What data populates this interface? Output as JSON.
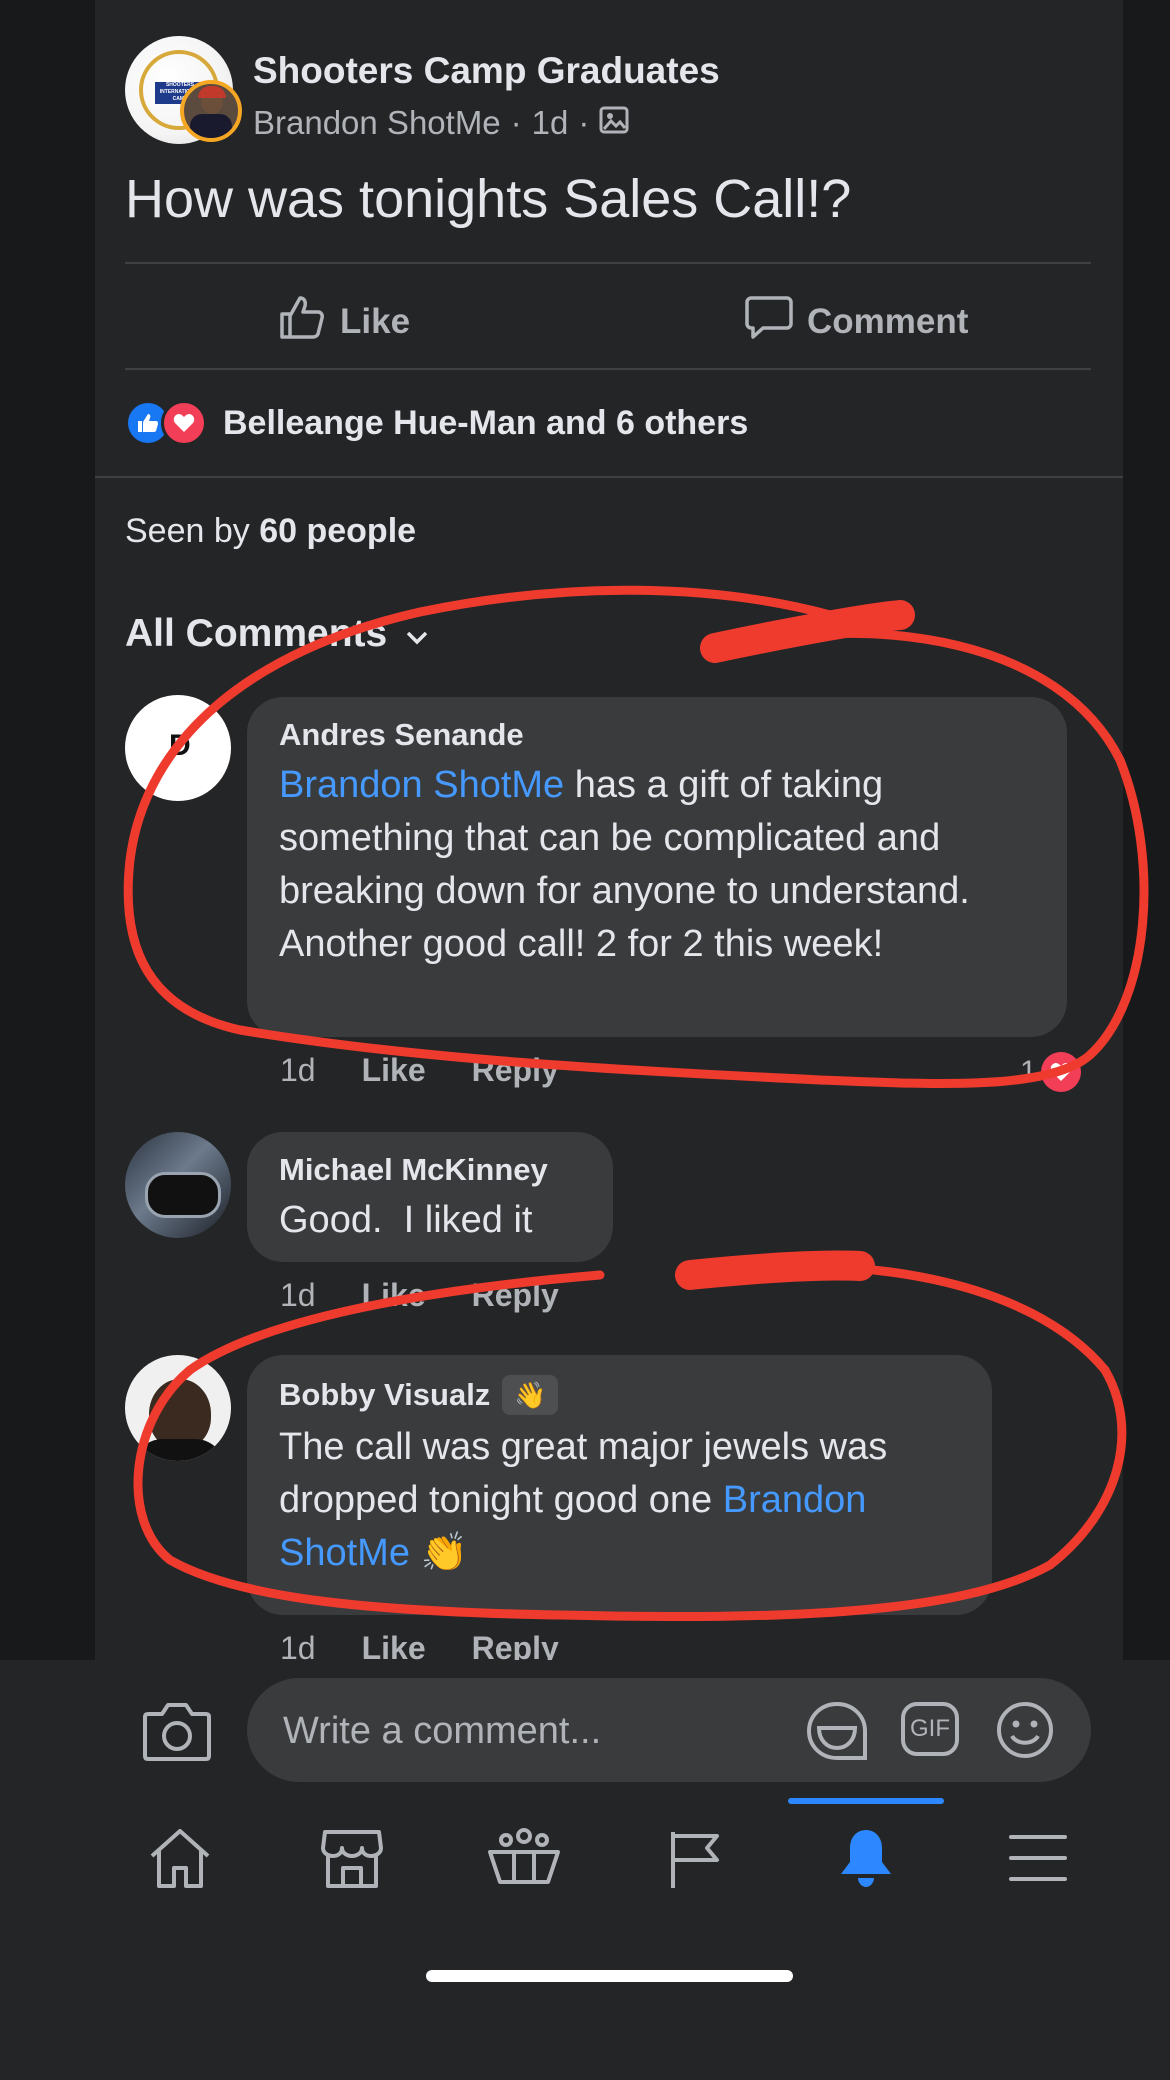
{
  "post": {
    "group_name": "Shooters Camp Graduates",
    "author": "Brandon ShotMe",
    "separator": "·",
    "time": "1d",
    "text": "How was tonights Sales Call!?",
    "like_label": "Like",
    "comment_label": "Comment",
    "reactions_text": "Belleange Hue-Man and 6 others",
    "seen_prefix": "Seen by",
    "seen_count": "60 people",
    "comments_filter": "All Comments"
  },
  "comments": [
    {
      "author": "Andres Senande",
      "avatar_initial": "D",
      "mention": "Brandon ShotMe",
      "text": " has a gift of taking something that can be complicated and breaking down for anyone to understand. Another good call! 2 for 2 this week!",
      "time": "1d",
      "like": "Like",
      "reply": "Reply",
      "reaction_count": "1"
    },
    {
      "author": "Michael McKinney",
      "text": "Good.  I liked it",
      "time": "1d",
      "like": "Like",
      "reply": "Reply"
    },
    {
      "author": "Bobby Visualz",
      "badge": "👋",
      "text": "The call was great major jewels was dropped tonight good one ",
      "mention": "Brandon ShotMe",
      "emoji": "👏",
      "time": "1d",
      "like": "Like",
      "reply": "Reply"
    }
  ],
  "composer": {
    "placeholder": "Write a comment...",
    "gif_label": "GIF"
  },
  "group_avatar_text": "SHOOTERS INTERNATIONAL CAMP",
  "colors": {
    "background": "#18191a",
    "card": "#242526",
    "bubble": "#3a3b3c",
    "accent": "#2d88ff",
    "mention": "#4599ff",
    "love": "#f33e58",
    "annotation": "#ee3b2e"
  },
  "icons": [
    "photo-icon",
    "like-icon",
    "comment-icon",
    "camera-icon",
    "sticker-icon",
    "gif-icon",
    "emoji-icon",
    "home-icon",
    "marketplace-icon",
    "groups-icon",
    "pages-icon",
    "notifications-icon",
    "menu-icon"
  ]
}
